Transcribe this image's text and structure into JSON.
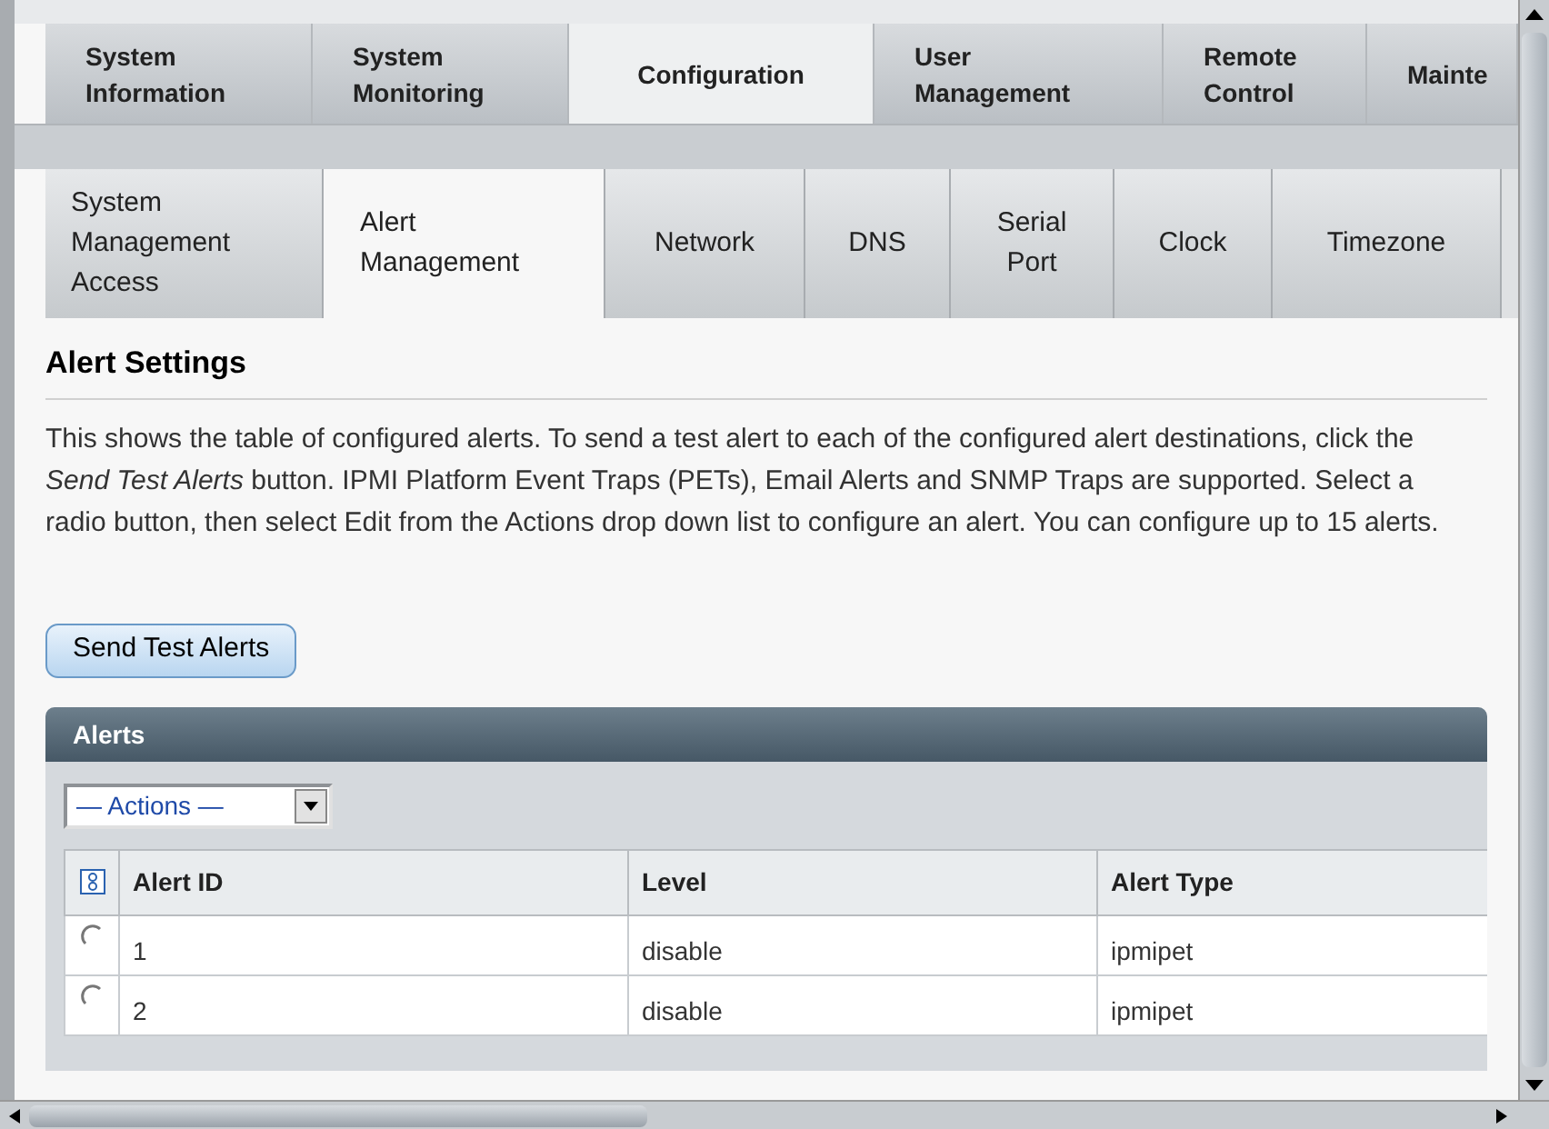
{
  "main_tabs": [
    {
      "label": "System Information",
      "selected": false
    },
    {
      "label": "System Monitoring",
      "selected": false
    },
    {
      "label": "Configuration",
      "selected": true
    },
    {
      "label": "User Management",
      "selected": false
    },
    {
      "label": "Remote Control",
      "selected": false
    },
    {
      "label": "Mainte",
      "selected": false
    }
  ],
  "sub_tabs": [
    {
      "label": "System Management Access",
      "selected": false
    },
    {
      "label": "Alert Management",
      "selected": true
    },
    {
      "label": "Network",
      "selected": false
    },
    {
      "label": "DNS",
      "selected": false
    },
    {
      "label": "Serial Port",
      "selected": false
    },
    {
      "label": "Clock",
      "selected": false
    },
    {
      "label": "Timezone",
      "selected": false
    }
  ],
  "section": {
    "title": "Alert Settings",
    "description": "This shows the table of configured alerts. To send a test alert to each of the configured alert destinations, click the *Send Test Alerts* button. IPMI Platform Event Traps (PETs), Email Alerts and SNMP Traps are supported. Select a radio button, then select Edit from the Actions drop down list to configure an alert. You can configure up to 15 alerts."
  },
  "send_button": "Send Test Alerts",
  "alerts_table": {
    "title": "Alerts",
    "actions_dropdown": "— Actions —",
    "columns": [
      "Alert ID",
      "Level",
      "Alert Type"
    ],
    "rows": [
      {
        "cells": [
          "1",
          "disable",
          "ipmipet"
        ],
        "selected": false
      },
      {
        "cells": [
          "2",
          "disable",
          "ipmipet"
        ],
        "selected": false
      }
    ]
  }
}
